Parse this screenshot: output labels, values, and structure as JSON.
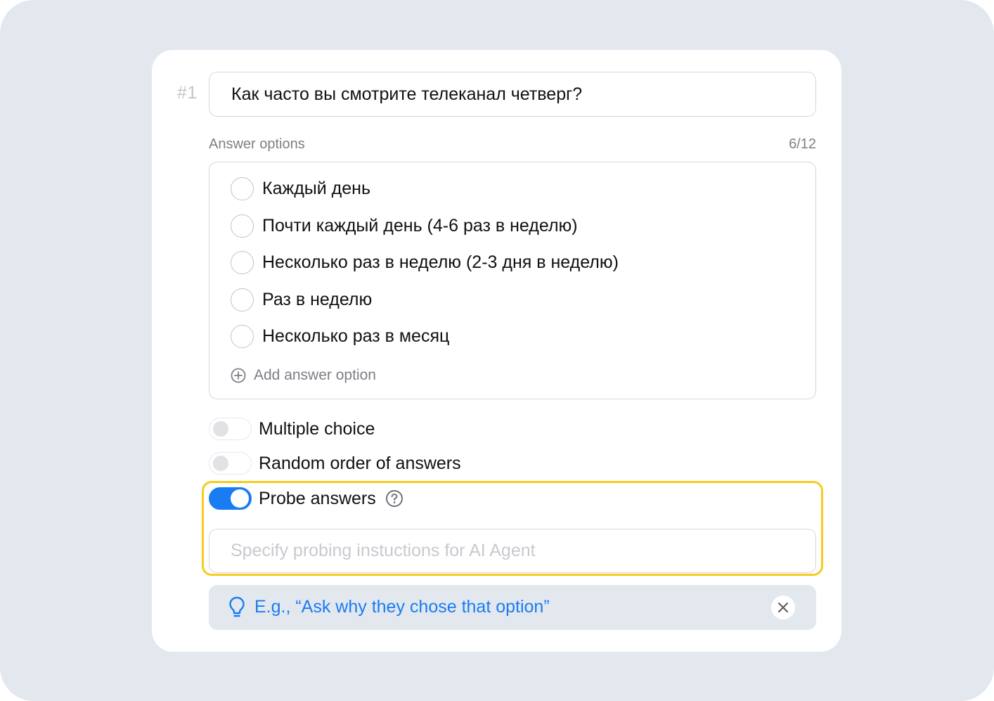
{
  "question": {
    "number": "#1",
    "text": "Как часто вы смотрите телеканал четверг?"
  },
  "answer_options": {
    "label": "Answer options",
    "count": "6/12",
    "items": [
      {
        "label": "Каждый день"
      },
      {
        "label": "Почти каждый день (4-6 раз в неделю)"
      },
      {
        "label": "Несколько раз в неделю (2-3 дня в неделю)"
      },
      {
        "label": "Раз в неделю"
      },
      {
        "label": "Несколько раз в месяц"
      }
    ],
    "add_label": "Add answer option"
  },
  "toggles": {
    "multiple_choice": {
      "label": "Multiple choice",
      "on": false
    },
    "random_order": {
      "label": "Random order of answers",
      "on": false
    },
    "probe_answers": {
      "label": "Probe answers",
      "on": true
    }
  },
  "probe": {
    "placeholder": "Specify probing instuctions for AI Agent"
  },
  "hint": {
    "text": "E.g., “Ask why they chose that option”"
  },
  "colors": {
    "accent": "#1a7cf2",
    "highlight": "#f5cc1f",
    "background": "#e3e8ef",
    "muted_text": "#7b7f86"
  },
  "icons": [
    "plus-circle-icon",
    "question-circle-icon",
    "lightbulb-icon",
    "close-icon"
  ]
}
